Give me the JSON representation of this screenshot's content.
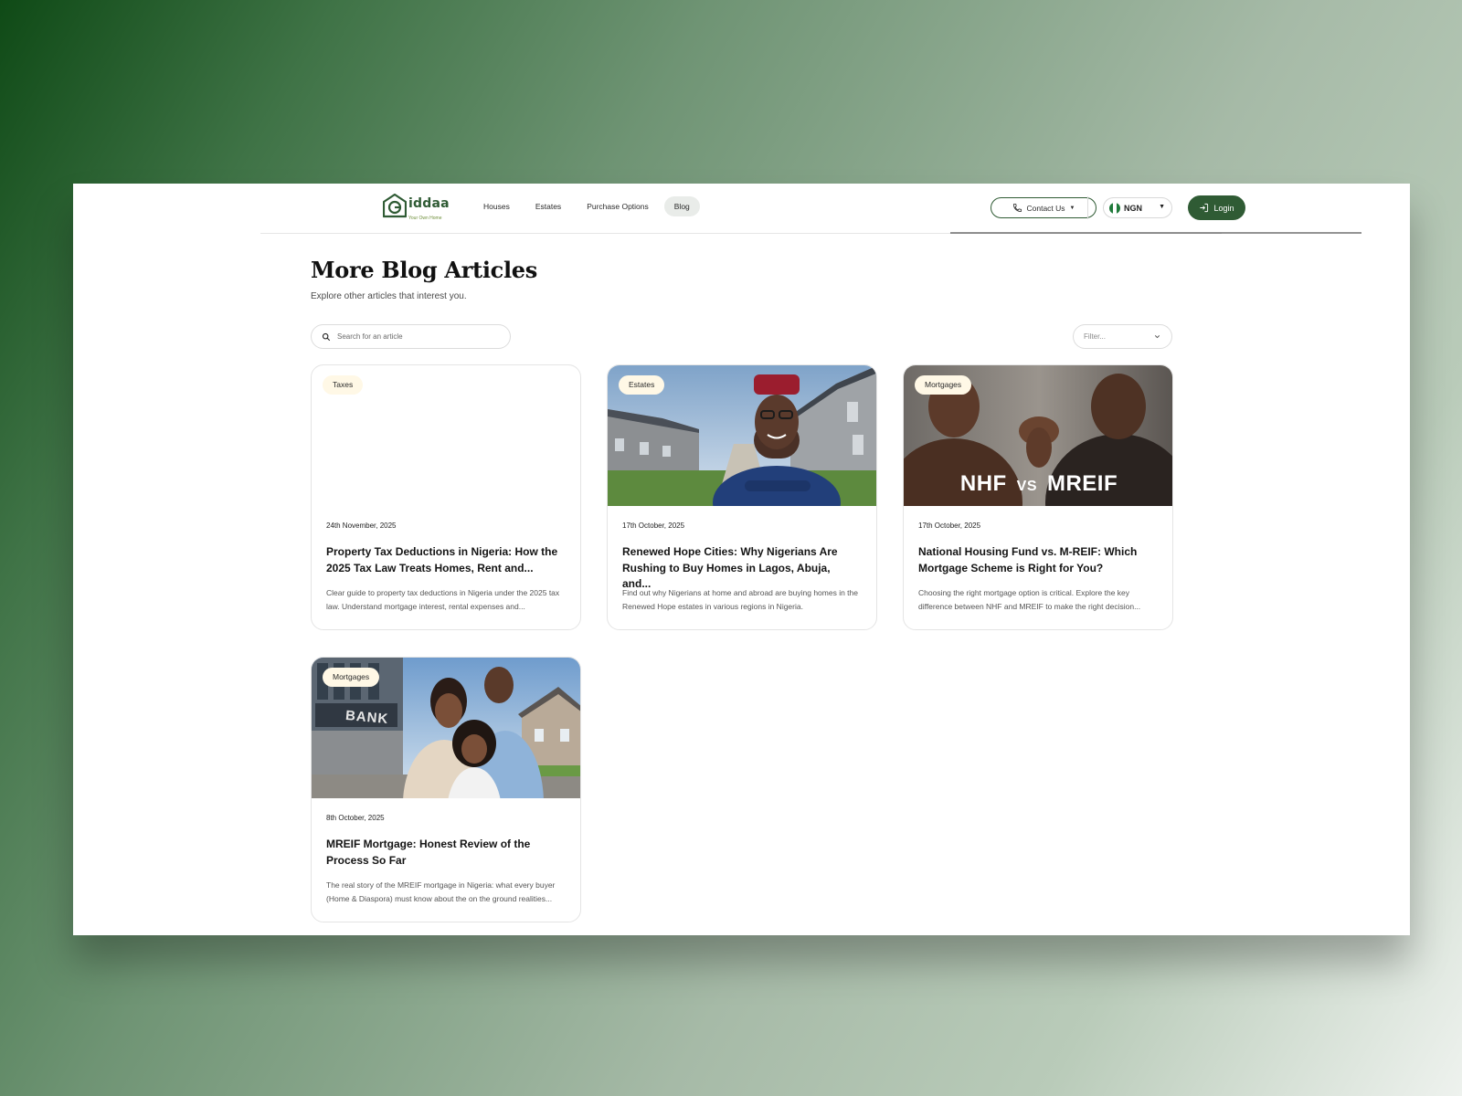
{
  "colors": {
    "brand_green": "#2f5b34",
    "tag_bg": "#fff8e6",
    "nav_active_bg": "#e9ece9"
  },
  "header": {
    "logo_text": "iddaa",
    "logo_tagline": "Your Own Home",
    "nav": [
      {
        "label": "Houses",
        "active": false
      },
      {
        "label": "Estates",
        "active": false
      },
      {
        "label": "Purchase Options",
        "active": false
      },
      {
        "label": "Blog",
        "active": true
      }
    ],
    "contact_label": "Contact Us",
    "contact_icon": "phone-icon",
    "currency_label": "NGN",
    "currency_flag": "nigeria-flag-icon",
    "login_label": "Login",
    "login_icon": "login-icon"
  },
  "main": {
    "title": "More Blog Articles",
    "subtitle": "Explore other articles that interest you.",
    "search": {
      "placeholder": "Search for an article",
      "icon": "search-icon"
    },
    "filter": {
      "placeholder": "Filter...",
      "icon": "chevron-down-icon"
    },
    "articles": [
      {
        "tag": "Taxes",
        "date": "24th November, 2025",
        "title": "Property Tax Deductions in Nigeria: How the 2025 Tax Law Treats Homes, Rent and...",
        "excerpt": "Clear guide to property tax deductions in Nigeria under the 2025 tax law. Understand mortgage interest, rental expenses and...",
        "image": "none"
      },
      {
        "tag": "Estates",
        "date": "17th October, 2025",
        "title": "Renewed Hope Cities: Why Nigerians Are Rushing to Buy Homes in Lagos, Abuja, and...",
        "excerpt": "Find out why Nigerians at home and abroad are buying homes in the Renewed Hope estates in various regions in Nigeria.",
        "image": "smiling man in red cap before estate houses"
      },
      {
        "tag": "Mortgages",
        "date": "17th October, 2025",
        "title": "National Housing Fund vs. M-REIF: Which Mortgage Scheme is Right for You?",
        "excerpt": "Choosing the right mortgage option is critical. Explore the key difference between NHF and MREIF to make the right decision...",
        "image_caption_left": "NHF",
        "image_caption_vs": "VS",
        "image_caption_right": "MREIF"
      },
      {
        "tag": "Mortgages",
        "date": "8th October, 2025",
        "title": "MREIF Mortgage: Honest Review of the Process So Far",
        "excerpt": "The real story of the MREIF mortgage in Nigeria: what every buyer (Home & Diaspora) must know about the on the ground realities...",
        "image_sign": "BANK"
      }
    ]
  }
}
